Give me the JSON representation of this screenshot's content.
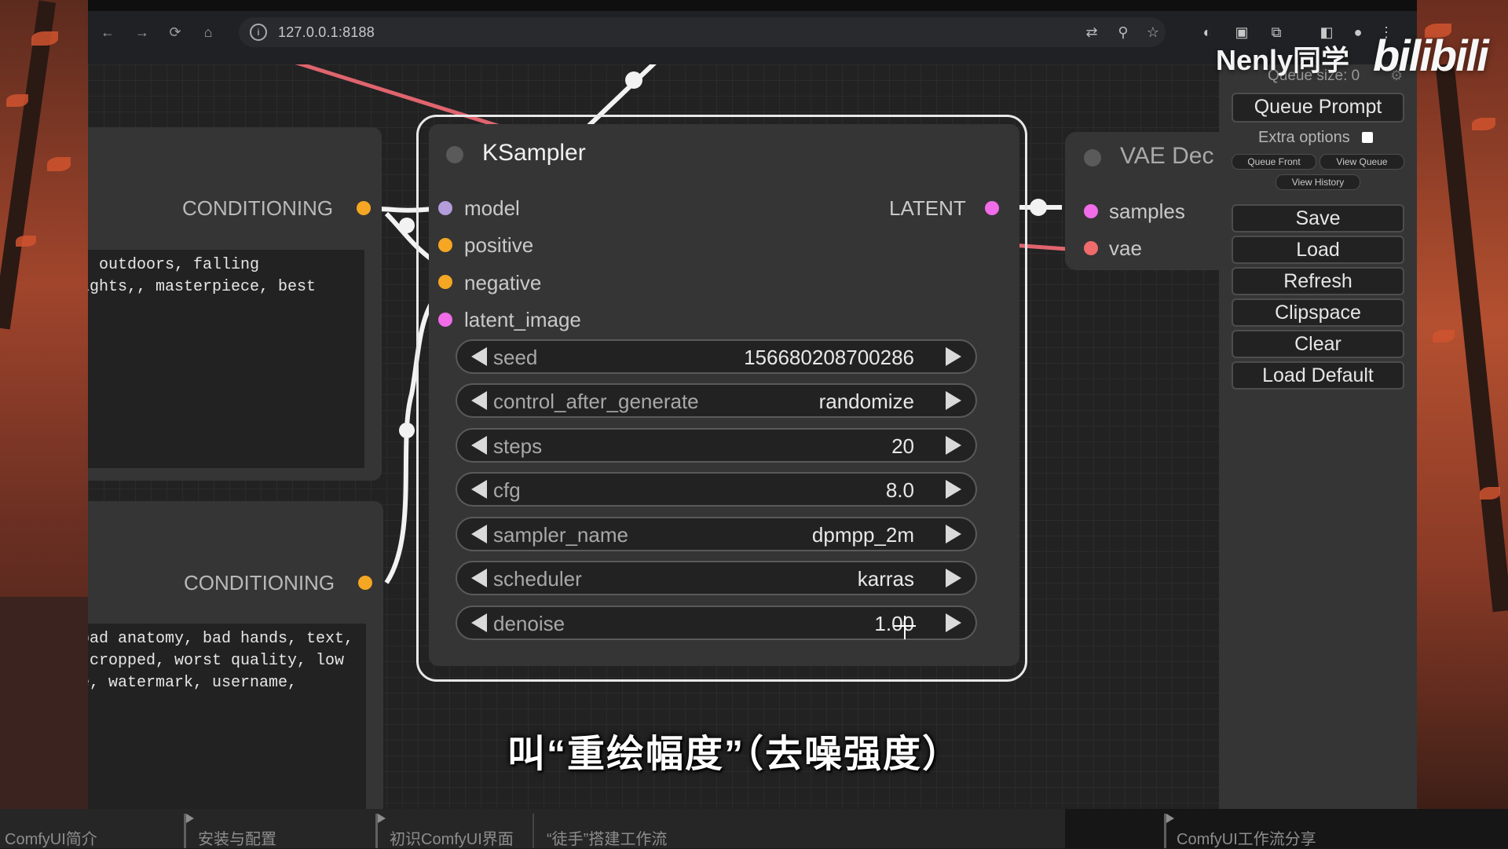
{
  "browser": {
    "url": "127.0.0.1:8188",
    "back_icon": "←",
    "forward_icon": "→",
    "reload_icon": "⟳",
    "home_icon": "⌂",
    "info_icon": "i",
    "translate_icon": "⇄",
    "zoom_icon": "⚲",
    "star_icon": "☆",
    "menu_icon": "⋮"
  },
  "watermark": {
    "user": "Nenly同学",
    "logo": "bilibili"
  },
  "left_nodes": {
    "top": {
      "output_label": "CONDITIONING",
      "text": ", outdoors, falling\nights,, masterpiece, best"
    },
    "bottom": {
      "output_label": "CONDITIONING",
      "text": "bad anatomy, bad hands, text,\n cropped, worst quality, low\ne, watermark, username,"
    }
  },
  "ksampler": {
    "title": "KSampler",
    "inputs": [
      "model",
      "positive",
      "negative",
      "latent_image"
    ],
    "output": "LATENT",
    "widgets": [
      {
        "name": "seed",
        "value": "156680208700286"
      },
      {
        "name": "control_after_generate",
        "value": "randomize"
      },
      {
        "name": "steps",
        "value": "20"
      },
      {
        "name": "cfg",
        "value": "8.0"
      },
      {
        "name": "sampler_name",
        "value": "dpmpp_2m"
      },
      {
        "name": "scheduler",
        "value": "karras"
      },
      {
        "name": "denoise",
        "value": "1.00"
      }
    ]
  },
  "vae_decode": {
    "title": "VAE Dec",
    "inputs": [
      "samples",
      "vae"
    ]
  },
  "panel": {
    "queue_size": "Queue size: 0",
    "queue_prompt": "Queue Prompt",
    "extra_options": "Extra options",
    "queue_front": "Queue Front",
    "view_queue": "View Queue",
    "view_history": "View History",
    "save": "Save",
    "load": "Load",
    "refresh": "Refresh",
    "clipspace": "Clipspace",
    "clear": "Clear",
    "load_default": "Load Default"
  },
  "subtitle": "叫“重绘幅度”（去噪强度）",
  "chapters": [
    "ComfyUI简介",
    "安装与配置",
    "初识ComfyUI界面",
    "“徒手”搭建工作流",
    "ComfyUI工作流分享"
  ],
  "colors": {
    "model_port": "#b39ddb",
    "conditioning_port": "#f5a623",
    "latent_port": "#f06ce8",
    "vae_port": "#f06b6b",
    "wire_red": "#e0646e",
    "wire_white": "#f2f2f2"
  }
}
